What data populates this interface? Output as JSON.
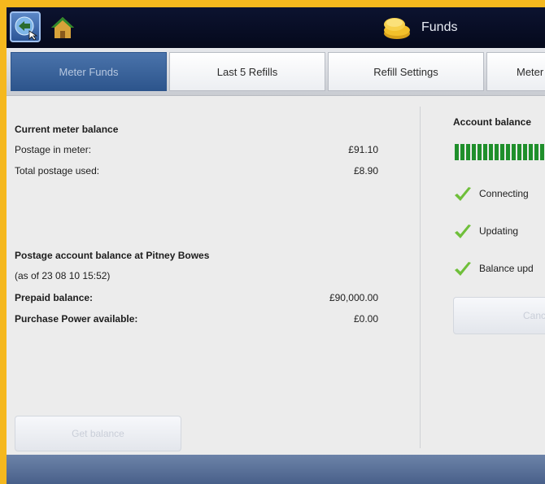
{
  "header": {
    "title": "Funds",
    "back_icon": "back-arrow-icon",
    "home_icon": "home-icon",
    "funds_icon": "coins-icon"
  },
  "tabs": [
    {
      "label": "Meter Funds",
      "active": true
    },
    {
      "label": "Last 5 Refills",
      "active": false
    },
    {
      "label": "Refill Settings",
      "active": false
    },
    {
      "label": "Meter",
      "active": false
    }
  ],
  "meter": {
    "heading": "Current meter balance",
    "postage_label": "Postage in meter:",
    "postage_value": "£91.10",
    "used_label": "Total postage used:",
    "used_value": "£8.90"
  },
  "account": {
    "heading": "Postage account balance at Pitney Bowes",
    "as_of": "(as of 23 08 10   15:52)",
    "prepaid_label": "Prepaid balance:",
    "prepaid_value": "£90,000.00",
    "power_label": "Purchase Power available:",
    "power_value": "£0.00",
    "button_label": "Get balance"
  },
  "status": {
    "heading": "Account balance",
    "steps": [
      "Connecting",
      "Updating",
      "Balance upd"
    ],
    "button_label": "Cancel",
    "progress_color": "#1f8f2b"
  }
}
